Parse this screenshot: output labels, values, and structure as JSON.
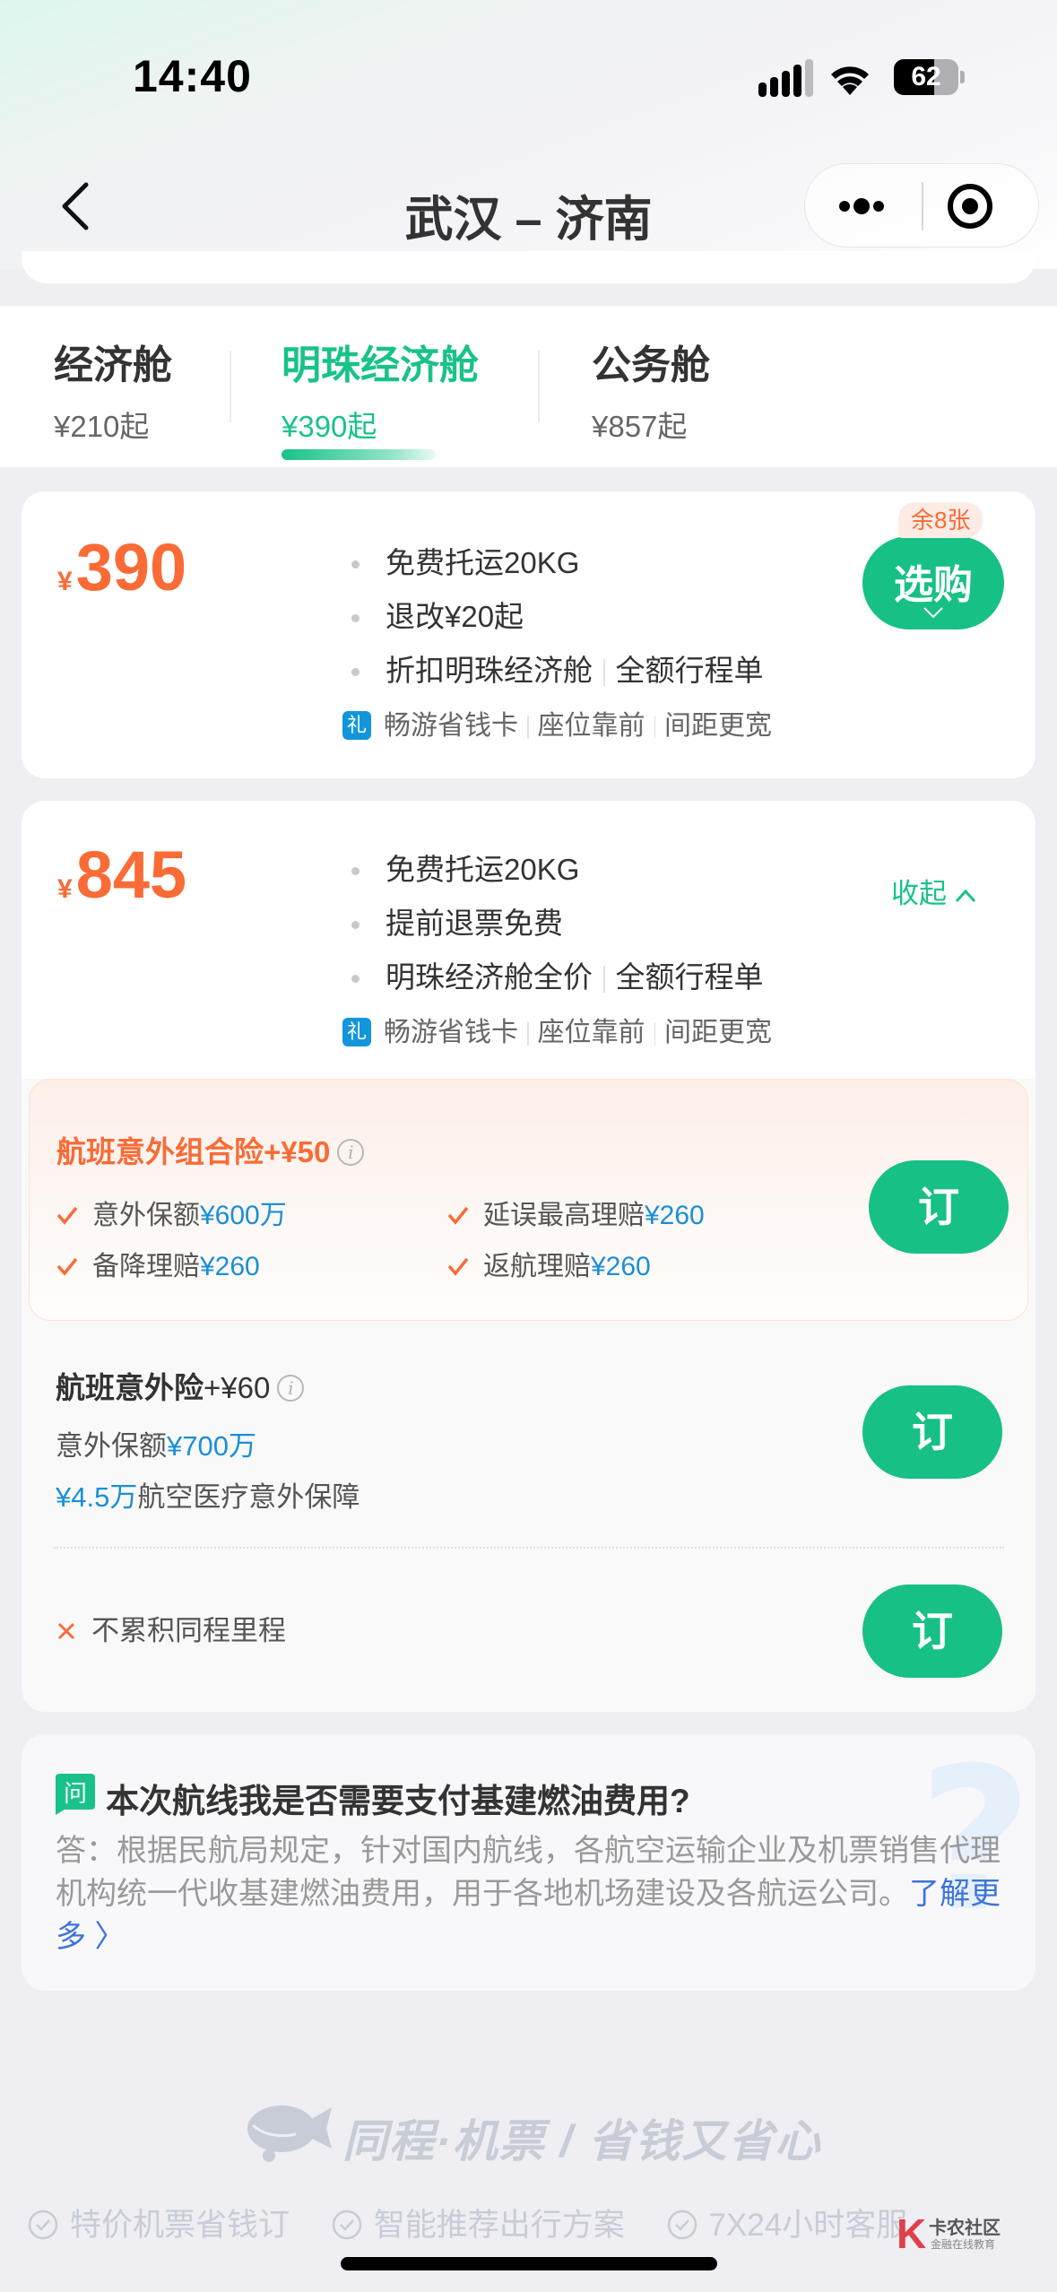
{
  "status_bar": {
    "time": "14:40",
    "battery_level": "62",
    "battery_fraction": 0.62
  },
  "nav": {
    "title": "武汉 – 济南",
    "back_icon": "chevron-left-icon",
    "more_icon": "more-dots-icon",
    "close_icon": "target-circle-icon"
  },
  "cabin_tabs": [
    {
      "name": "经济舱",
      "price": "¥210起",
      "active": false
    },
    {
      "name": "明珠经济舱",
      "price": "¥390起",
      "active": true
    },
    {
      "name": "公务舱",
      "price": "¥857起",
      "active": false
    }
  ],
  "fares": [
    {
      "currency": "¥",
      "price": "390",
      "features": [
        "免费托运20KG",
        "退改¥20起"
      ],
      "feature_line3": [
        "折扣明珠经济舱",
        "全额行程单"
      ],
      "perk_icon_label": "礼",
      "perks": [
        "畅游省钱卡",
        "座位靠前",
        "间距更宽"
      ],
      "remaining": "余8张",
      "select_label": "选购"
    },
    {
      "currency": "¥",
      "price": "845",
      "features": [
        "免费托运20KG",
        "提前退票免费"
      ],
      "feature_line3": [
        "明珠经济舱全价",
        "全额行程单"
      ],
      "perk_icon_label": "礼",
      "perks": [
        "畅游省钱卡",
        "座位靠前",
        "间距更宽"
      ],
      "collapse_label": "收起"
    }
  ],
  "insurance_options": {
    "combo": {
      "title": "航班意外组合险+¥50",
      "items": [
        {
          "label": "意外保额",
          "value": "¥600万"
        },
        {
          "label": "延误最高理赔",
          "value": "¥260"
        },
        {
          "label": "备降理赔",
          "value": "¥260"
        },
        {
          "label": "返航理赔",
          "value": "¥260"
        }
      ],
      "book_label": "订"
    },
    "basic": {
      "title": "航班意外险",
      "price": "+¥60",
      "line1_label": "意外保额",
      "line1_value": "¥700万",
      "line2_value": "¥4.5万",
      "line2_label": "航空医疗意外保障",
      "book_label": "订"
    },
    "none": {
      "label": "不累积同程里程",
      "book_label": "订"
    }
  },
  "faq": {
    "icon_label": "问",
    "question": "本次航线我是否需要支付基建燃油费用?",
    "answer": "答：根据民航局规定，针对国内航线，各航空运输企业及机票销售代理机构统一代收基建燃油费用，用于各地机场建设及各航运公司。",
    "link": "了解更多 〉"
  },
  "footer": {
    "brand": "同程·机票 / 省钱又省心",
    "features": [
      "特价机票省钱订",
      "智能推荐出行方案",
      "7X24小时客服"
    ]
  },
  "watermark": {
    "title": "卡农社区",
    "subtitle": "金融在线教育"
  },
  "colors": {
    "brand_green": "#17c084",
    "price_orange": "#fa6b36",
    "highlight_blue": "#1a8fd6",
    "link_blue": "#3d74d9"
  }
}
